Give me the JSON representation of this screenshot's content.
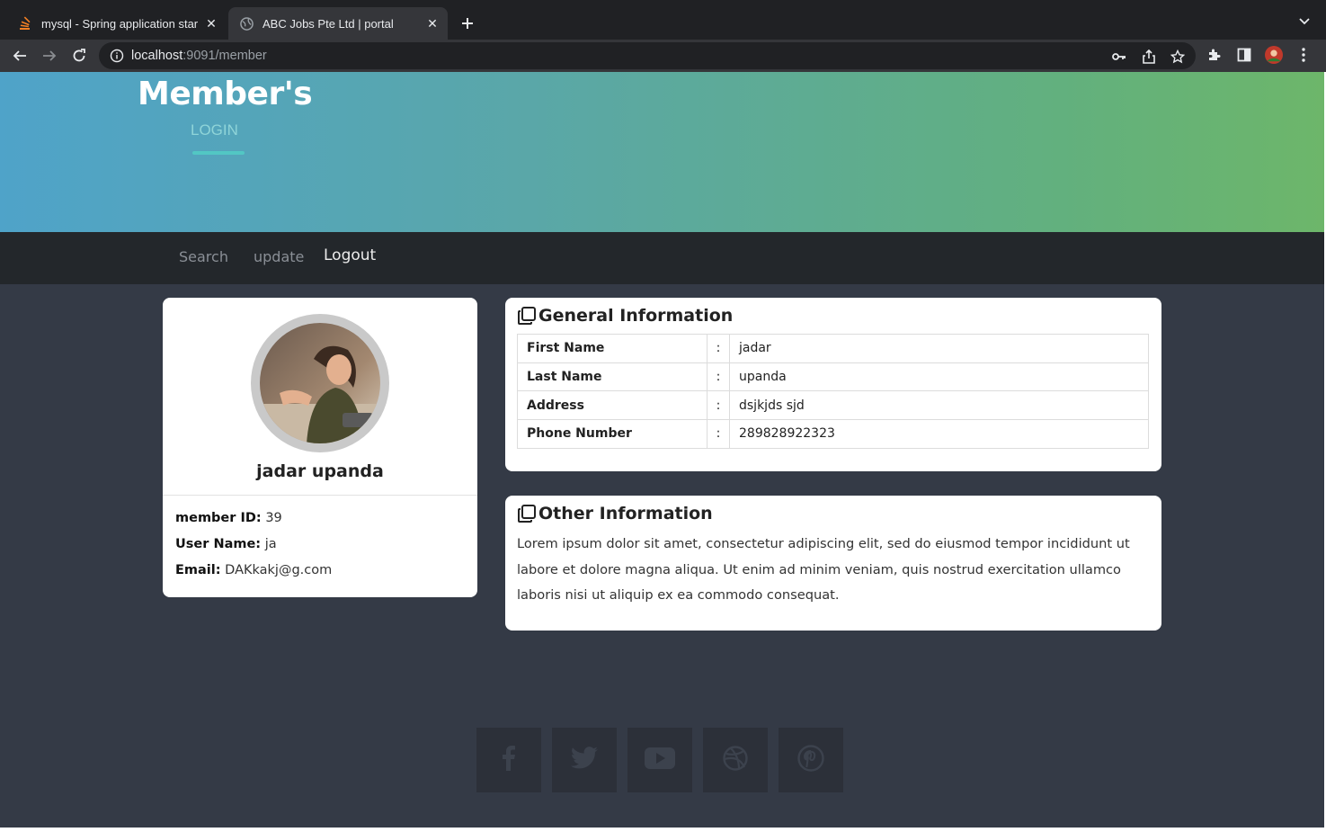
{
  "browser": {
    "tabs": [
      {
        "title": "mysql - Spring application star",
        "active": false
      },
      {
        "title": "ABC Jobs Pte Ltd | portal",
        "active": true
      }
    ],
    "url_host": "localhost",
    "url_path": ":9091/member"
  },
  "hero": {
    "title": "Member's",
    "subtitle": "LOGIN"
  },
  "nav": {
    "items": [
      {
        "label": "Search",
        "active": false
      },
      {
        "label": "update",
        "active": false
      },
      {
        "label": "Logout",
        "active": true
      }
    ]
  },
  "profile": {
    "name": "jadar upanda",
    "member_id_label": "member ID:",
    "member_id": "39",
    "username_label": "User Name:",
    "username": "ja",
    "email_label": "Email:",
    "email": "DAKkakj@g.com"
  },
  "general": {
    "title": "General Information",
    "rows": [
      {
        "key": "First Name",
        "sep": ":",
        "value": "jadar"
      },
      {
        "key": "Last Name",
        "sep": ":",
        "value": "upanda"
      },
      {
        "key": "Address",
        "sep": ":",
        "value": "dsjkjds sjd"
      },
      {
        "key": "Phone Number",
        "sep": ":",
        "value": "289828922323"
      }
    ]
  },
  "other": {
    "title": "Other Information",
    "text": "Lorem ipsum dolor sit amet, consectetur adipiscing elit, sed do eiusmod tempor incididunt ut labore et dolore magna aliqua. Ut enim ad minim veniam, quis nostrud exercitation ullamco laboris nisi ut aliquip ex ea commodo consequat."
  },
  "social": [
    "facebook-icon",
    "twitter-icon",
    "youtube-icon",
    "dribbble-icon",
    "pinterest-icon"
  ],
  "colors": {
    "hero_start": "#4fa3c9",
    "hero_end": "#6db66a",
    "page_bg": "#343a46",
    "navbar_bg": "#23272b"
  }
}
